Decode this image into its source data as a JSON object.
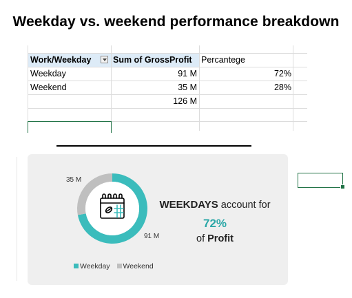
{
  "title": "Weekday vs. weekend performance breakdown",
  "pivot": {
    "headers": [
      "Work/Weekday",
      "Sum of GrossProfit",
      "Percantege"
    ],
    "rows": [
      {
        "label": "Weekday",
        "profit": "91 M",
        "pct": "72%"
      },
      {
        "label": "Weekend",
        "profit": "35 M",
        "pct": "28%"
      }
    ],
    "total": "126 M"
  },
  "card": {
    "label_weekend": "35 M",
    "label_weekday": "91 M",
    "kpi": {
      "strong": "WEEKDAYS",
      "rest": " account for",
      "pct": "72%",
      "of": "of ",
      "metric": "Profit"
    },
    "legend": [
      {
        "name": "Weekday",
        "color": "#3bbcbc"
      },
      {
        "name": "Weekend",
        "color": "#bfbfbf"
      }
    ],
    "chart_data": {
      "type": "pie",
      "categories": [
        "Weekday",
        "Weekend"
      ],
      "values": [
        72,
        28
      ],
      "colors": [
        "#3bbcbc",
        "#bfbfbf"
      ]
    }
  },
  "colors": {
    "accent": "#3bbcbc",
    "pct_text": "#2aa7a7",
    "header_fill": "#ddebf7",
    "selection": "#217346"
  },
  "icons": {
    "center": "calendar-icon"
  }
}
